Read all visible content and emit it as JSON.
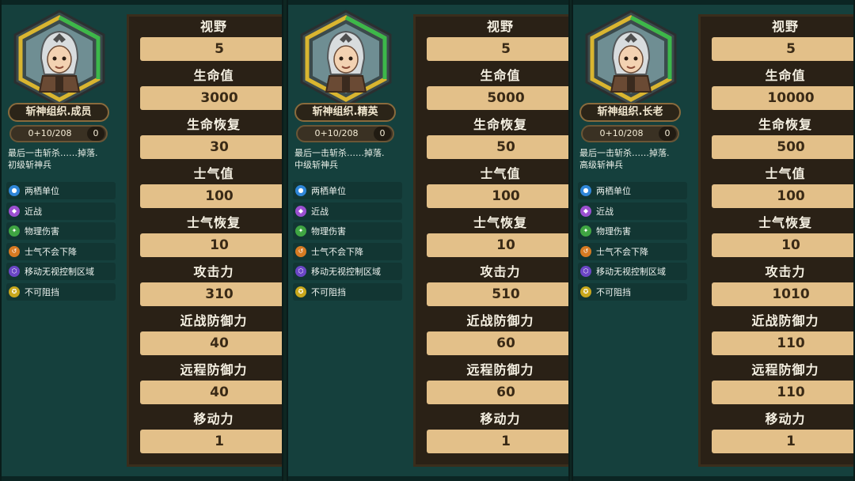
{
  "panels": [
    {
      "name": "斩神组织.成员",
      "xp": "0+10/208",
      "level": "0",
      "description": "最后一击斩杀……掉落.\n初级斩神兵",
      "traits": [
        {
          "icon": "unit-icon",
          "label": "两栖单位",
          "color": "#2f86d8",
          "glyph": "●"
        },
        {
          "icon": "melee-icon",
          "label": "近战",
          "color": "#9b4fd0",
          "glyph": "◆"
        },
        {
          "icon": "physical-damage-icon",
          "label": "物理伤害",
          "color": "#3fa542",
          "glyph": "✦"
        },
        {
          "icon": "morale-icon",
          "label": "士气不会下降",
          "color": "#d67a22",
          "glyph": "↺"
        },
        {
          "icon": "ignore-control-icon",
          "label": "移动无视控制区域",
          "color": "#6b46c6",
          "glyph": "⬡"
        },
        {
          "icon": "unstoppable-icon",
          "label": "不可阻挡",
          "color": "#c9a71c",
          "glyph": "✪"
        }
      ],
      "stats": [
        {
          "label": "视野",
          "value": "5"
        },
        {
          "label": "生命值",
          "value": "3000"
        },
        {
          "label": "生命恢复",
          "value": "30"
        },
        {
          "label": "士气值",
          "value": "100"
        },
        {
          "label": "士气恢复",
          "value": "10"
        },
        {
          "label": "攻击力",
          "value": "310"
        },
        {
          "label": "近战防御力",
          "value": "40"
        },
        {
          "label": "远程防御力",
          "value": "40"
        },
        {
          "label": "移动力",
          "value": "1"
        }
      ]
    },
    {
      "name": "斩神组织.精英",
      "xp": "0+10/208",
      "level": "0",
      "description": "最后一击斩杀……掉落.\n中级斩神兵",
      "traits": [
        {
          "icon": "unit-icon",
          "label": "两栖单位",
          "color": "#2f86d8",
          "glyph": "●"
        },
        {
          "icon": "melee-icon",
          "label": "近战",
          "color": "#9b4fd0",
          "glyph": "◆"
        },
        {
          "icon": "physical-damage-icon",
          "label": "物理伤害",
          "color": "#3fa542",
          "glyph": "✦"
        },
        {
          "icon": "morale-icon",
          "label": "士气不会下降",
          "color": "#d67a22",
          "glyph": "↺"
        },
        {
          "icon": "ignore-control-icon",
          "label": "移动无视控制区域",
          "color": "#6b46c6",
          "glyph": "⬡"
        },
        {
          "icon": "unstoppable-icon",
          "label": "不可阻挡",
          "color": "#c9a71c",
          "glyph": "✪"
        }
      ],
      "stats": [
        {
          "label": "视野",
          "value": "5"
        },
        {
          "label": "生命值",
          "value": "5000"
        },
        {
          "label": "生命恢复",
          "value": "50"
        },
        {
          "label": "士气值",
          "value": "100"
        },
        {
          "label": "士气恢复",
          "value": "10"
        },
        {
          "label": "攻击力",
          "value": "510"
        },
        {
          "label": "近战防御力",
          "value": "60"
        },
        {
          "label": "远程防御力",
          "value": "60"
        },
        {
          "label": "移动力",
          "value": "1"
        }
      ]
    },
    {
      "name": "斩神组织.长老",
      "xp": "0+10/208",
      "level": "0",
      "description": "最后一击斩杀……掉落.\n高级斩神兵",
      "traits": [
        {
          "icon": "unit-icon",
          "label": "两栖单位",
          "color": "#2f86d8",
          "glyph": "●"
        },
        {
          "icon": "melee-icon",
          "label": "近战",
          "color": "#9b4fd0",
          "glyph": "◆"
        },
        {
          "icon": "physical-damage-icon",
          "label": "物理伤害",
          "color": "#3fa542",
          "glyph": "✦"
        },
        {
          "icon": "morale-icon",
          "label": "士气不会下降",
          "color": "#d67a22",
          "glyph": "↺"
        },
        {
          "icon": "ignore-control-icon",
          "label": "移动无视控制区域",
          "color": "#6b46c6",
          "glyph": "⬡"
        },
        {
          "icon": "unstoppable-icon",
          "label": "不可阻挡",
          "color": "#c9a71c",
          "glyph": "✪"
        }
      ],
      "stats": [
        {
          "label": "视野",
          "value": "5"
        },
        {
          "label": "生命值",
          "value": "10000"
        },
        {
          "label": "生命恢复",
          "value": "500"
        },
        {
          "label": "士气值",
          "value": "100"
        },
        {
          "label": "士气恢复",
          "value": "10"
        },
        {
          "label": "攻击力",
          "value": "1010"
        },
        {
          "label": "近战防御力",
          "value": "110"
        },
        {
          "label": "远程防御力",
          "value": "110"
        },
        {
          "label": "移动力",
          "value": "1"
        }
      ]
    }
  ]
}
